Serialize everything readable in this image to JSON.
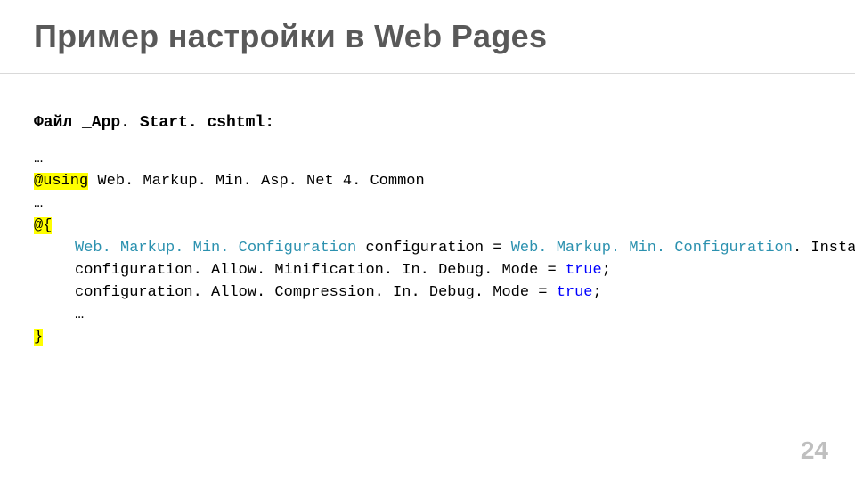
{
  "title": "Пример настройки в Web Pages",
  "file_label": "Файл _App. Start. cshtml:",
  "code": {
    "ellipsis": "…",
    "at_using": "@using",
    "using_rest": " Web. Markup. Min. Asp. Net 4. Common",
    "at_open": "@{",
    "line1_type": "Web. Markup. Min. Configuration",
    "line1_mid": " configuration = ",
    "line1_type2": "Web. Markup. Min. Configuration",
    "line1_end": ". Instance;",
    "line2_a": "configuration. Allow. Minification. In. Debug. Mode = ",
    "kw_true": "true",
    "semicolon": ";",
    "line3_a": "configuration. Allow. Compression. In. Debug. Mode = ",
    "close_brace": "}"
  },
  "page_number": "24"
}
